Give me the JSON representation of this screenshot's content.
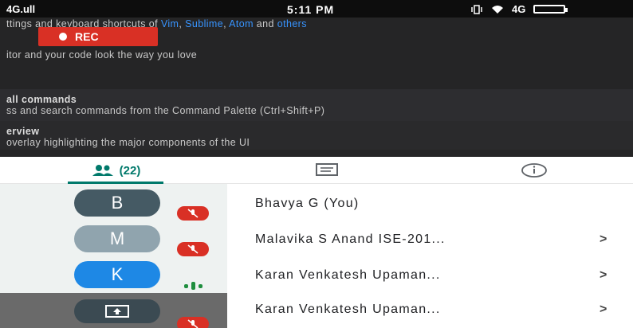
{
  "status_bar": {
    "left": "4G.ull",
    "time": "5:11 PM",
    "right_network": "4G"
  },
  "recording": {
    "label": "REC"
  },
  "welcome": {
    "line1_prefix": "ttings and keyboard shortcuts of ",
    "line1_vim": "Vim",
    "line1_sublime": "Sublime",
    "line1_atom": "Atom",
    "line1_and": " and ",
    "line1_others": "others",
    "line2": "itor and your code look the way you love",
    "line3": "all commands",
    "line4": "ss and search commands from the Command Palette (Ctrl+Shift+P)",
    "line5": "erview",
    "line6": "overlay highlighting the major components of the UI"
  },
  "tabs": {
    "people_count": "(22)"
  },
  "participants": [
    {
      "initial": "B",
      "name": "Bhavya G (You)",
      "avatar_color": "#455a64",
      "status": "muted",
      "chevron": ""
    },
    {
      "initial": "M",
      "name": "Malavika S Anand ISE-201...",
      "avatar_color": "#90a4ae",
      "status": "muted",
      "chevron": ">"
    },
    {
      "initial": "K",
      "name": "Karan Venkatesh Upaman...",
      "avatar_color": "#1e88e5",
      "status": "speaking",
      "chevron": ">"
    },
    {
      "initial": "",
      "name": "Karan Venkatesh Upaman...",
      "avatar_color": "#3b4a52",
      "status": "muted",
      "chevron": ">"
    }
  ],
  "colors": {
    "accent": "#00796b",
    "mute_red": "#d93025",
    "speaking_green": "#1e8e3e"
  }
}
